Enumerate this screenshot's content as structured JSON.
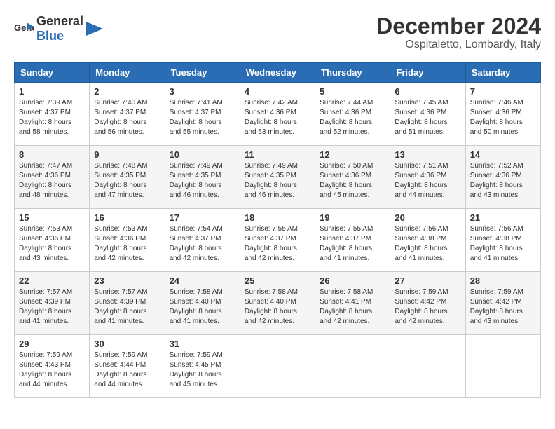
{
  "header": {
    "logo_general": "General",
    "logo_blue": "Blue",
    "month": "December 2024",
    "location": "Ospitaletto, Lombardy, Italy"
  },
  "weekdays": [
    "Sunday",
    "Monday",
    "Tuesday",
    "Wednesday",
    "Thursday",
    "Friday",
    "Saturday"
  ],
  "weeks": [
    [
      {
        "day": "1",
        "sunrise": "7:39 AM",
        "sunset": "4:37 PM",
        "daylight": "8 hours and 58 minutes."
      },
      {
        "day": "2",
        "sunrise": "7:40 AM",
        "sunset": "4:37 PM",
        "daylight": "8 hours and 56 minutes."
      },
      {
        "day": "3",
        "sunrise": "7:41 AM",
        "sunset": "4:37 PM",
        "daylight": "8 hours and 55 minutes."
      },
      {
        "day": "4",
        "sunrise": "7:42 AM",
        "sunset": "4:36 PM",
        "daylight": "8 hours and 53 minutes."
      },
      {
        "day": "5",
        "sunrise": "7:44 AM",
        "sunset": "4:36 PM",
        "daylight": "8 hours and 52 minutes."
      },
      {
        "day": "6",
        "sunrise": "7:45 AM",
        "sunset": "4:36 PM",
        "daylight": "8 hours and 51 minutes."
      },
      {
        "day": "7",
        "sunrise": "7:46 AM",
        "sunset": "4:36 PM",
        "daylight": "8 hours and 50 minutes."
      }
    ],
    [
      {
        "day": "8",
        "sunrise": "7:47 AM",
        "sunset": "4:36 PM",
        "daylight": "8 hours and 48 minutes."
      },
      {
        "day": "9",
        "sunrise": "7:48 AM",
        "sunset": "4:35 PM",
        "daylight": "8 hours and 47 minutes."
      },
      {
        "day": "10",
        "sunrise": "7:49 AM",
        "sunset": "4:35 PM",
        "daylight": "8 hours and 46 minutes."
      },
      {
        "day": "11",
        "sunrise": "7:49 AM",
        "sunset": "4:35 PM",
        "daylight": "8 hours and 46 minutes."
      },
      {
        "day": "12",
        "sunrise": "7:50 AM",
        "sunset": "4:36 PM",
        "daylight": "8 hours and 45 minutes."
      },
      {
        "day": "13",
        "sunrise": "7:51 AM",
        "sunset": "4:36 PM",
        "daylight": "8 hours and 44 minutes."
      },
      {
        "day": "14",
        "sunrise": "7:52 AM",
        "sunset": "4:36 PM",
        "daylight": "8 hours and 43 minutes."
      }
    ],
    [
      {
        "day": "15",
        "sunrise": "7:53 AM",
        "sunset": "4:36 PM",
        "daylight": "8 hours and 43 minutes."
      },
      {
        "day": "16",
        "sunrise": "7:53 AM",
        "sunset": "4:36 PM",
        "daylight": "8 hours and 42 minutes."
      },
      {
        "day": "17",
        "sunrise": "7:54 AM",
        "sunset": "4:37 PM",
        "daylight": "8 hours and 42 minutes."
      },
      {
        "day": "18",
        "sunrise": "7:55 AM",
        "sunset": "4:37 PM",
        "daylight": "8 hours and 42 minutes."
      },
      {
        "day": "19",
        "sunrise": "7:55 AM",
        "sunset": "4:37 PM",
        "daylight": "8 hours and 41 minutes."
      },
      {
        "day": "20",
        "sunrise": "7:56 AM",
        "sunset": "4:38 PM",
        "daylight": "8 hours and 41 minutes."
      },
      {
        "day": "21",
        "sunrise": "7:56 AM",
        "sunset": "4:38 PM",
        "daylight": "8 hours and 41 minutes."
      }
    ],
    [
      {
        "day": "22",
        "sunrise": "7:57 AM",
        "sunset": "4:39 PM",
        "daylight": "8 hours and 41 minutes."
      },
      {
        "day": "23",
        "sunrise": "7:57 AM",
        "sunset": "4:39 PM",
        "daylight": "8 hours and 41 minutes."
      },
      {
        "day": "24",
        "sunrise": "7:58 AM",
        "sunset": "4:40 PM",
        "daylight": "8 hours and 41 minutes."
      },
      {
        "day": "25",
        "sunrise": "7:58 AM",
        "sunset": "4:40 PM",
        "daylight": "8 hours and 42 minutes."
      },
      {
        "day": "26",
        "sunrise": "7:58 AM",
        "sunset": "4:41 PM",
        "daylight": "8 hours and 42 minutes."
      },
      {
        "day": "27",
        "sunrise": "7:59 AM",
        "sunset": "4:42 PM",
        "daylight": "8 hours and 42 minutes."
      },
      {
        "day": "28",
        "sunrise": "7:59 AM",
        "sunset": "4:42 PM",
        "daylight": "8 hours and 43 minutes."
      }
    ],
    [
      {
        "day": "29",
        "sunrise": "7:59 AM",
        "sunset": "4:43 PM",
        "daylight": "8 hours and 44 minutes."
      },
      {
        "day": "30",
        "sunrise": "7:59 AM",
        "sunset": "4:44 PM",
        "daylight": "8 hours and 44 minutes."
      },
      {
        "day": "31",
        "sunrise": "7:59 AM",
        "sunset": "4:45 PM",
        "daylight": "8 hours and 45 minutes."
      },
      null,
      null,
      null,
      null
    ]
  ],
  "labels": {
    "sunrise": "Sunrise:",
    "sunset": "Sunset:",
    "daylight": "Daylight:"
  }
}
